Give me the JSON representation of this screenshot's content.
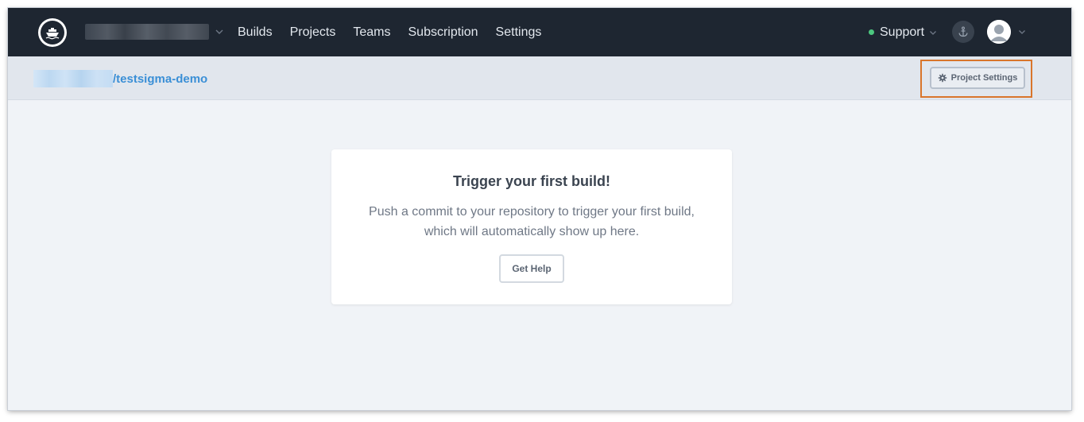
{
  "navbar": {
    "links": [
      "Builds",
      "Projects",
      "Teams",
      "Subscription",
      "Settings"
    ],
    "support_label": "Support",
    "support_status_color": "#4cc77f"
  },
  "icons": {
    "logo": "ship-logo-icon",
    "org_chevron": "chevron-down-icon",
    "support_chevron": "chevron-down-icon",
    "anchor": "anchor-icon",
    "avatar": "user-avatar-icon",
    "avatar_chevron": "chevron-down-icon",
    "gear": "gear-icon"
  },
  "subheader": {
    "repo_name": "/testsigma-demo",
    "project_settings_label": "Project Settings",
    "highlight_color": "#d9752b"
  },
  "card": {
    "title": "Trigger your first build!",
    "text_line1": "Push a commit to your repository to trigger your first build,",
    "text_line2": "which will automatically show up here.",
    "button_label": "Get Help"
  },
  "colors": {
    "navbar_bg": "#1e2631",
    "page_bg": "#f0f3f7",
    "link_blue": "#3a8fd6"
  }
}
